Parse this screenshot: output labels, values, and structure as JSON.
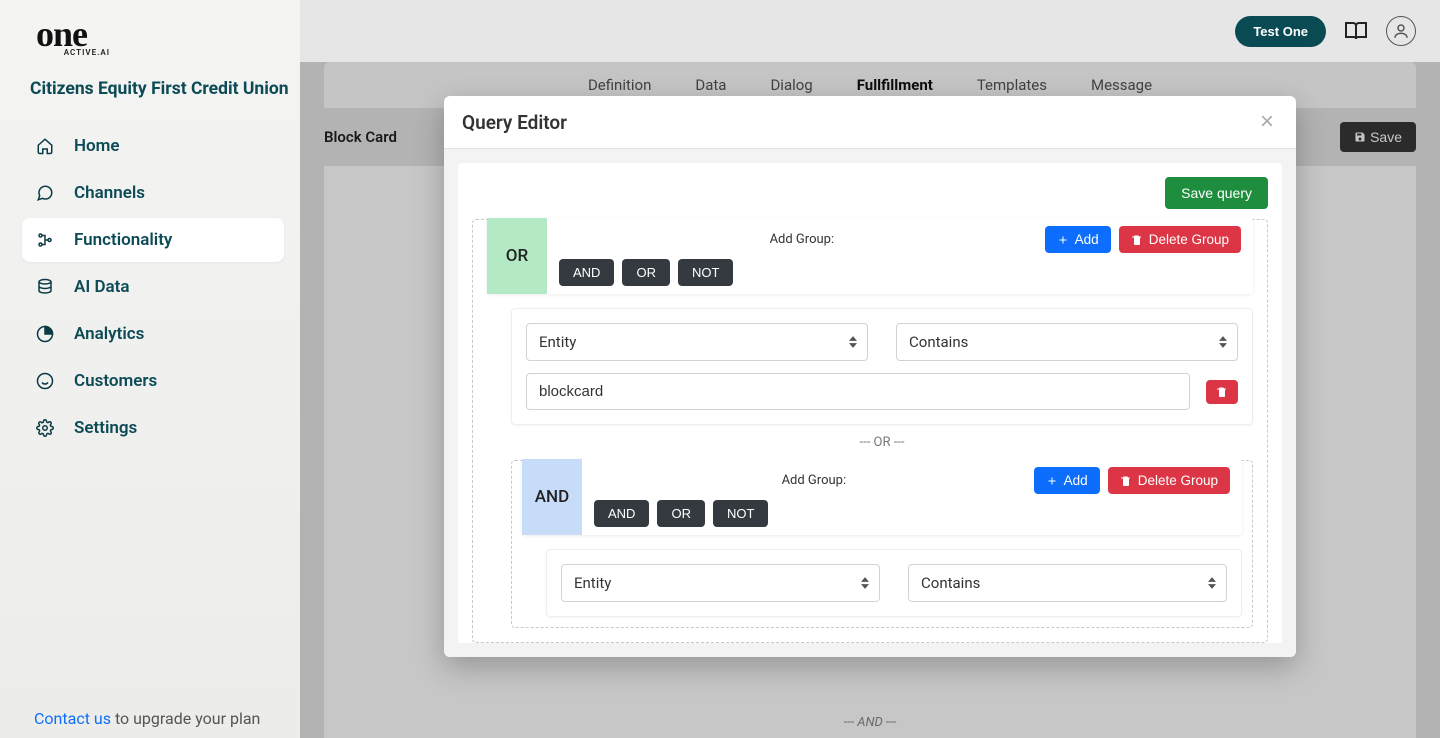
{
  "logo": {
    "main": "one",
    "sub": "ACTIVE.AI"
  },
  "org": "Citizens Equity First Credit Union",
  "nav": [
    {
      "key": "home",
      "label": "Home"
    },
    {
      "key": "channels",
      "label": "Channels"
    },
    {
      "key": "functionality",
      "label": "Functionality",
      "active": true
    },
    {
      "key": "aidata",
      "label": "AI Data"
    },
    {
      "key": "analytics",
      "label": "Analytics"
    },
    {
      "key": "customers",
      "label": "Customers"
    },
    {
      "key": "settings",
      "label": "Settings"
    }
  ],
  "upgrade": {
    "link": "Contact us",
    "rest": " to upgrade your plan"
  },
  "topbar": {
    "test": "Test One"
  },
  "tabs": {
    "definition": "Definition",
    "data": "Data",
    "dialog": "Dialog",
    "fulfillment": "Fullfillment",
    "templates": "Templates",
    "message": "Message",
    "active": "fulfillment"
  },
  "page": {
    "title": "Block Card",
    "save": "Save"
  },
  "behind": {
    "and_sep": "--- AND ---"
  },
  "modal": {
    "title": "Query Editor",
    "save_query": "Save query",
    "add_group": "Add Group:",
    "add": "Add",
    "delete_group": "Delete Group",
    "ops": {
      "and": "AND",
      "or": "OR",
      "not": "NOT"
    },
    "or_sep": "--- OR ---",
    "group1": {
      "badge": "OR",
      "cond": {
        "field": "Entity",
        "op": "Contains",
        "value": "blockcard"
      }
    },
    "group2": {
      "badge": "AND",
      "cond": {
        "field": "Entity",
        "op": "Contains"
      }
    }
  }
}
